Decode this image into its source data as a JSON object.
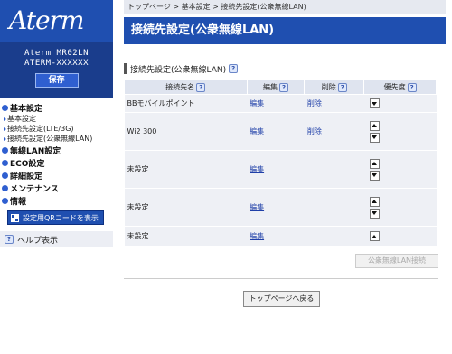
{
  "brand": {
    "logo": "Aterm",
    "model": "Aterm MR02LN",
    "device_id": "ATERM-XXXXXX",
    "save_label": "保存"
  },
  "nav": {
    "items": [
      {
        "label": "基本設定",
        "subs": [
          "基本設定",
          "接続先設定(LTE/3G)",
          "接続先設定(公衆無線LAN)"
        ]
      },
      {
        "label": "無線LAN設定"
      },
      {
        "label": "ECO設定"
      },
      {
        "label": "詳細設定"
      },
      {
        "label": "メンテナンス"
      },
      {
        "label": "情報"
      }
    ],
    "qr_label": "設定用QRコードを表示",
    "help_label": "ヘルプ表示"
  },
  "breadcrumb": "トップページ > 基本設定 > 接続先設定(公衆無線LAN)",
  "header_title": "接続先設定(公衆無線LAN)",
  "section_title": "接続先設定(公衆無線LAN)",
  "table": {
    "headers": [
      "接続先名",
      "編集",
      "削除",
      "優先度"
    ],
    "rows": [
      {
        "name": "BBモバイルポイント",
        "edit": "編集",
        "del": "削除"
      },
      {
        "name": "Wi2 300",
        "edit": "編集",
        "del": "削除"
      },
      {
        "name": "未設定",
        "edit": "編集",
        "del": ""
      },
      {
        "name": "未設定",
        "edit": "編集",
        "del": ""
      },
      {
        "name": "未設定",
        "edit": "編集",
        "del": ""
      }
    ]
  },
  "connect_label": "公衆無線LAN接続",
  "top_page_label": "トップページへ戻る",
  "help_glyph": "?"
}
